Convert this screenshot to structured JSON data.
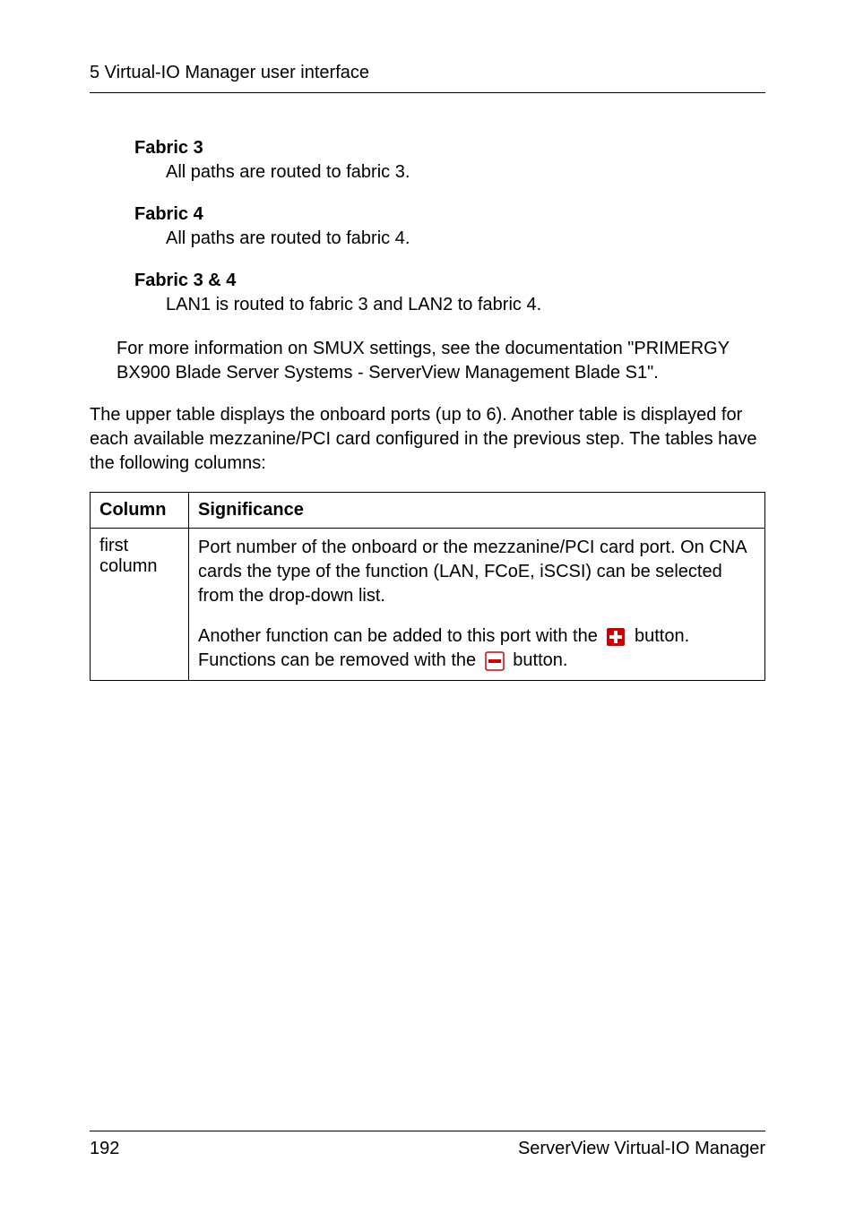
{
  "header": "5 Virtual-IO Manager user interface",
  "fabric3": {
    "title": "Fabric 3",
    "body": "All paths are routed to fabric 3."
  },
  "fabric4": {
    "title": "Fabric 4",
    "body": "All paths are routed to fabric 4."
  },
  "fabric34": {
    "title": "Fabric 3 & 4",
    "body": "LAN1 is routed to fabric 3 and LAN2 to fabric 4."
  },
  "smux_info": "For more information on SMUX settings, see the documentation \"PRIMERGY BX900 Blade Server Systems - ServerView Management Blade S1\".",
  "upper_table_intro": "The upper table displays the onboard ports (up to 6). Another table is displayed for each available mezzanine/PCI card configured in the previous step. The tables have the following columns:",
  "table": {
    "col1_header": "Column",
    "col2_header": "Significance",
    "row1_col1": "first column",
    "row1_col2_p1": "Port number of the onboard or the mezzanine/PCI card port. On CNA cards the type of the function (LAN, FCoE, iSCSI) can be selected from the drop-down list.",
    "row1_col2_p2a": "Another function can be added to this port with the ",
    "row1_col2_p2b": " button. Functions can be removed with the ",
    "row1_col2_p2c": " button."
  },
  "footer": {
    "page": "192",
    "product": "ServerView Virtual-IO Manager"
  }
}
